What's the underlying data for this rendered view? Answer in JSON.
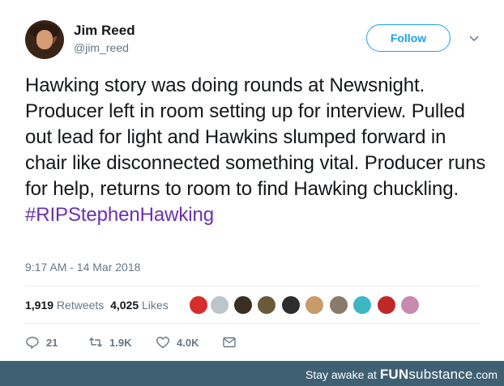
{
  "user": {
    "name": "Jim Reed",
    "handle": "@jim_reed"
  },
  "follow_label": "Follow",
  "tweet": {
    "text": "Hawking story was doing rounds at Newsnight. Producer left in room setting up for interview. Pulled out lead for light and Hawkins slumped forward in chair like disconnected something vital. Producer runs for help, returns to room to find Hawking chuckling. ",
    "hashtag": "#RIPStephenHawking"
  },
  "timestamp": "9:17 AM - 14 Mar 2018",
  "stats": {
    "retweets_count": "1,919",
    "retweets_label": "Retweets",
    "likes_count": "4,025",
    "likes_label": "Likes"
  },
  "actions": {
    "reply": "21",
    "retweet": "1.9K",
    "like": "4.0K"
  },
  "footer": {
    "prefix": "Stay awake at ",
    "brand_main": "FUN",
    "brand_sub": "substance",
    "brand_tld": ".com"
  },
  "colors": {
    "accent": "#1da1f2",
    "hashtag": "#6b2fb3",
    "footer_bg": "#3f5f72",
    "muted": "#657786"
  }
}
